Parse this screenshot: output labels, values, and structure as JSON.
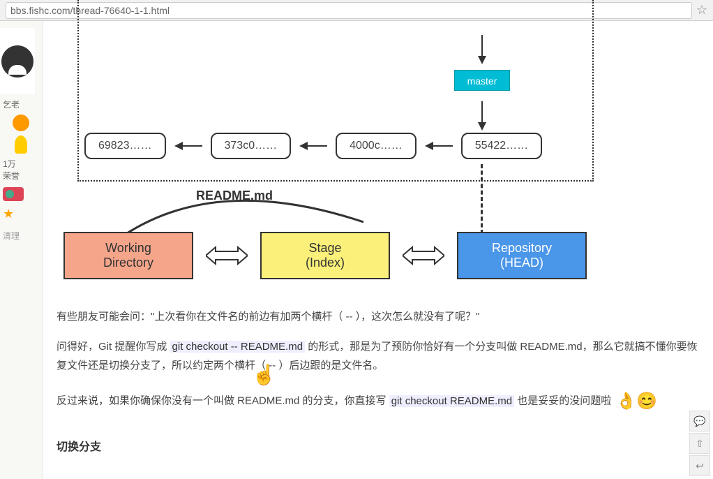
{
  "url": "bbs.fishc.com/thread-76640-1-1.html",
  "sidebar": {
    "role": "乞老",
    "stats_count": "1万",
    "stats_label": "荣誉",
    "bottom_link": "清理"
  },
  "diagram": {
    "master_label": "master",
    "commits": [
      "69823……",
      "373c0……",
      "4000c……",
      "55422……"
    ],
    "readme_label": "README.md",
    "working_line1": "Working",
    "working_line2": "Directory",
    "stage_line1": "Stage",
    "stage_line2": "(Index)",
    "repo_line1": "Repository",
    "repo_line2": "(HEAD)"
  },
  "text": {
    "para1": "有些朋友可能会问：\"上次看你在文件名的前边有加两个横杆（ -- ），这次怎么就没有了呢？\"",
    "para2a": "问得好，Git 提醒你写成 ",
    "cmd1": "git checkout -- README.md",
    "para2b": " 的形式，那是为了预防你恰好有一个分支叫做 README.md，那么它就搞不懂你要恢复文件还是切换分支了，所以约定两个横杆（ -- ）后边跟的是文件名。",
    "para3a": "反过来说，如果你确保你没有一个叫做 README.md 的分支，你直接写 ",
    "cmd2": "git checkout README.md",
    "para3b": " 也是妥妥的没问题啦 ",
    "section": "切换分支"
  }
}
